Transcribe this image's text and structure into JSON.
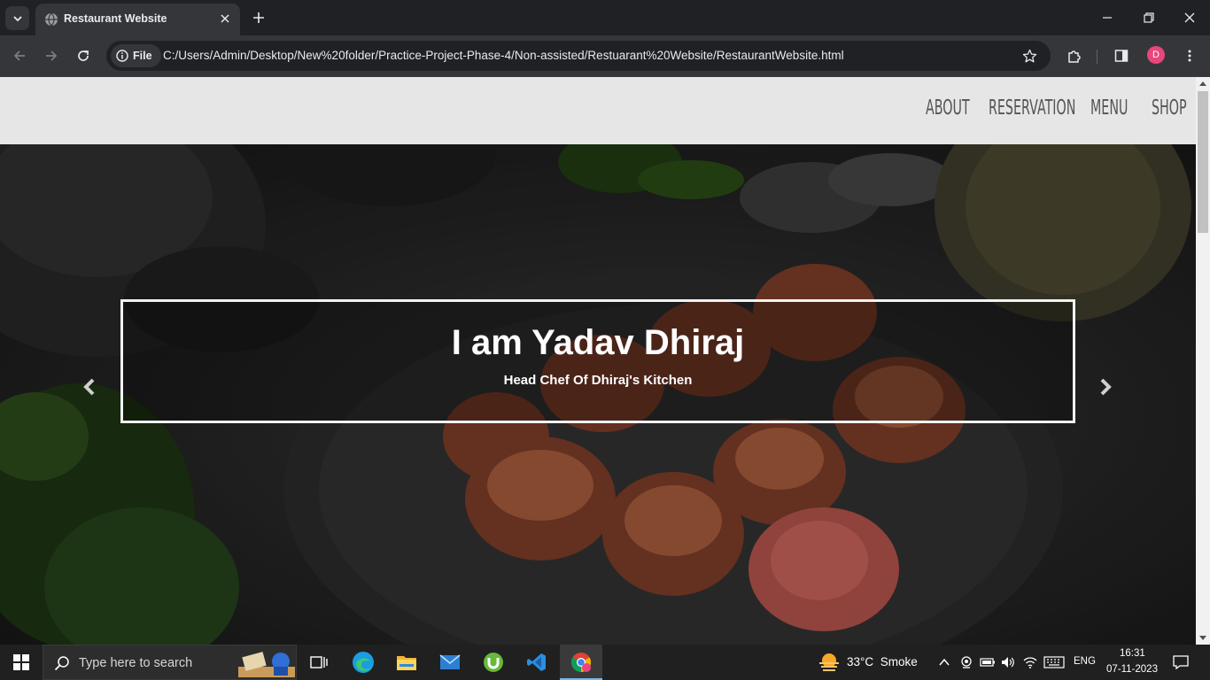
{
  "browser": {
    "tab_title": "Restaurant Website",
    "file_chip_label": "File",
    "url": "C:/Users/Admin/Desktop/New%20folder/Practice-Project-Phase-4/Non-assisted/Restuarant%20Website/RestaurantWebsite.html",
    "profile_initial": "D"
  },
  "site": {
    "nav": [
      "ABOUT",
      "RESERVATION",
      "MENU",
      "SHOP"
    ],
    "hero": {
      "title": "I am Yadav Dhiraj",
      "subtitle": "Head Chef Of Dhiraj's Kitchen"
    }
  },
  "taskbar": {
    "search_placeholder": "Type here to search",
    "weather_temp": "33°C",
    "weather_desc": "Smoke",
    "language": "ENG",
    "time": "16:31",
    "date": "07-11-2023"
  }
}
